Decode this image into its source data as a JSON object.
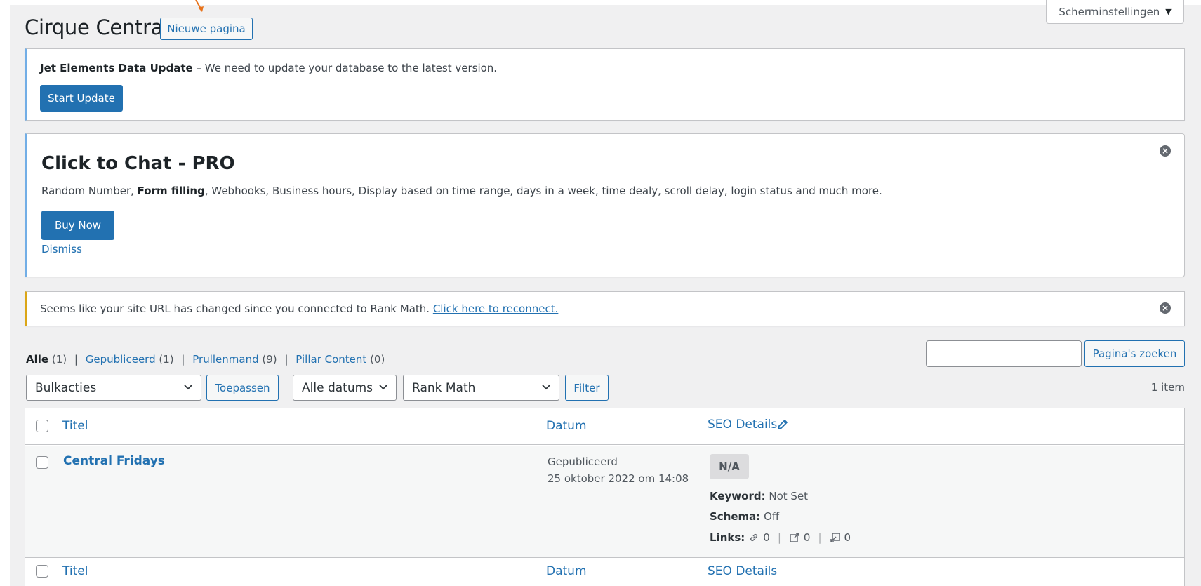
{
  "screen_options": {
    "label": "Scherminstellingen",
    "caret": "▼"
  },
  "header": {
    "title": "Cirque Central",
    "new_page_button": "Nieuwe pagina"
  },
  "notices": {
    "jet": {
      "title": "Jet Elements Data Update",
      "text": " – We need to update your database to the latest version.",
      "button": "Start Update"
    },
    "chat": {
      "heading": "Click to Chat - PRO",
      "text_before": "Random Number, ",
      "text_bold": "Form filling",
      "text_after": ", Webhooks, Business hours, Display based on time range, days in a week, time dealy, scroll delay, login status and much more.",
      "button": "Buy Now",
      "dismiss": "Dismiss"
    },
    "rankmath": {
      "text": "Seems like your site URL has changed since you connected to Rank Math. ",
      "link": "Click here to reconnect."
    }
  },
  "filters": {
    "all": {
      "label": "Alle",
      "count": "(1)"
    },
    "published": {
      "label": "Gepubliceerd",
      "count": "(1)"
    },
    "trash": {
      "label": "Prullenmand",
      "count": "(9)"
    },
    "pillar": {
      "label": "Pillar Content",
      "count": "(0)"
    },
    "separator": "|"
  },
  "search": {
    "value": "",
    "button": "Pagina's zoeken"
  },
  "toolbar": {
    "bulk_select": "Bulkacties",
    "apply_button": "Toepassen",
    "dates_select": "Alle datums",
    "rankmath_select": "Rank Math",
    "filter_button": "Filter",
    "item_count": "1 item"
  },
  "table": {
    "columns": {
      "title": "Titel",
      "date": "Datum",
      "seo": "SEO Details"
    },
    "rows": [
      {
        "title": "Central Fridays",
        "status": "Gepubliceerd",
        "date": "25 oktober 2022 om 14:08",
        "score": "N/A",
        "keyword_label": "Keyword:",
        "keyword_value": " Not Set",
        "schema_label": "Schema:",
        "schema_value": " Off",
        "links_label": "Links:",
        "internal_links": "0",
        "external_links": "0",
        "incoming_links": "0"
      }
    ]
  },
  "colors": {
    "accent": "#2271b1",
    "info_border": "#72aee6",
    "warning_border": "#dba617",
    "arrow": "#e8731b"
  }
}
